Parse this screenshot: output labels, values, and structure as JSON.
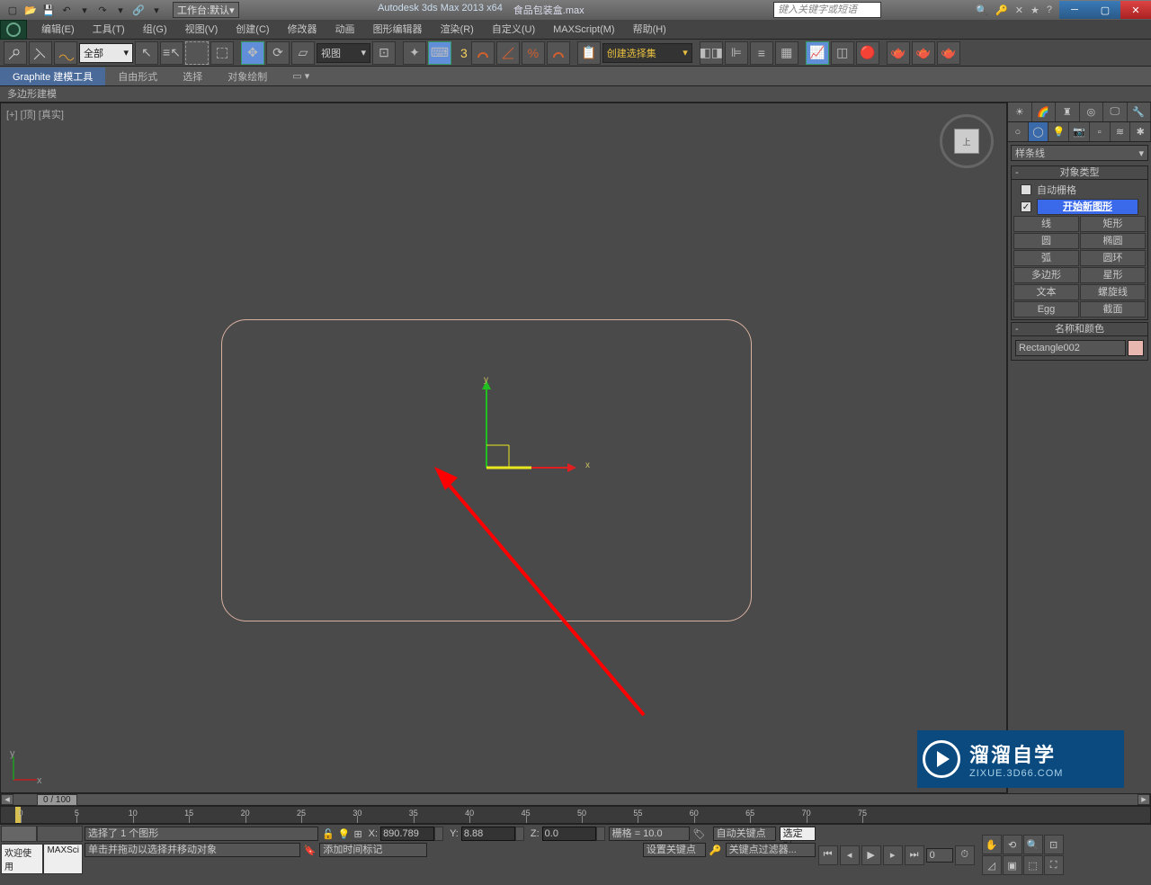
{
  "title": {
    "app": "Autodesk 3ds Max  2013 x64",
    "file": "食品包装盒.max",
    "workspace_label": "工作台:",
    "workspace_value": "默认",
    "search_placeholder": "键入关键字或短语"
  },
  "menus": [
    "编辑(E)",
    "工具(T)",
    "组(G)",
    "视图(V)",
    "创建(C)",
    "修改器",
    "动画",
    "图形编辑器",
    "渲染(R)",
    "自定义(U)",
    "MAXScript(M)",
    "帮助(H)"
  ],
  "toolbar": {
    "filter": "全部",
    "refcoord": "视图",
    "selset": "创建选择集"
  },
  "ribbon": {
    "tabs": [
      "Graphite 建模工具",
      "自由形式",
      "选择",
      "对象绘制"
    ],
    "sub": "多边形建模"
  },
  "viewport": {
    "label": "[+] [顶] [真实]",
    "axis_x": "x",
    "axis_y": "y"
  },
  "cmd": {
    "dropdown": "样条线",
    "rollout1": "对象类型",
    "autogrid": "自动栅格",
    "startnew": "开始新图形",
    "buttons": [
      "线",
      "矩形",
      "圆",
      "椭圆",
      "弧",
      "圆环",
      "多边形",
      "星形",
      "文本",
      "螺旋线",
      "Egg",
      "截面"
    ],
    "rollout2": "名称和颜色",
    "name": "Rectangle002"
  },
  "time": {
    "range": "0 / 100",
    "ticks": [
      0,
      5,
      10,
      15,
      20,
      25,
      30,
      35,
      40,
      45,
      50,
      55,
      60,
      65,
      70,
      75
    ]
  },
  "status": {
    "welcome": "欢迎使用",
    "maxs": "MAXSci",
    "sel": "选择了 1 个图形",
    "hint": "单击并拖动以选择并移动对象",
    "x": "X:",
    "xv": "890.789",
    "y": "Y:",
    "yv": "8.88",
    "z": "Z:",
    "zv": "0.0",
    "grid": "栅格 = 10.0",
    "addtm": "添加时间标记",
    "autokey": "自动关键点",
    "selonly": "选定对",
    "setkey": "设置关键点",
    "keyfilt": "关键点过滤器..."
  },
  "watermark": {
    "big": "溜溜自学",
    "small": "ZIXUE.3D66.COM"
  }
}
